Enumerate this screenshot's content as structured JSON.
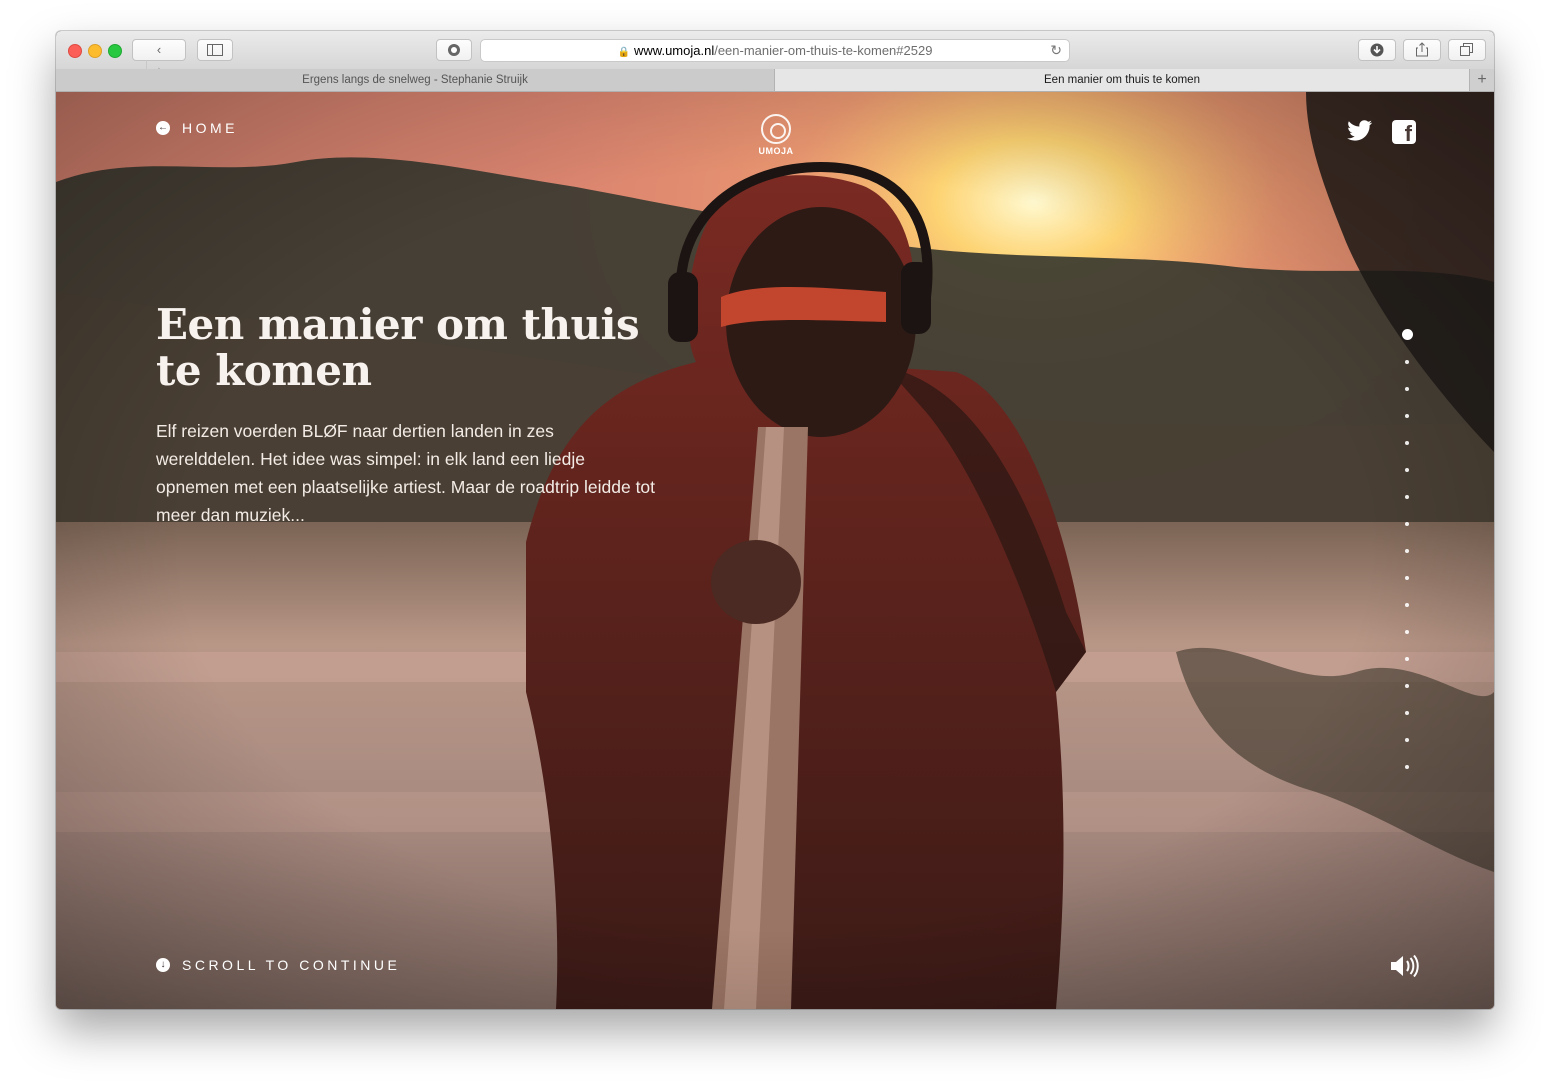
{
  "browser": {
    "url_host": "www.umoja.nl",
    "url_path": "/een-manier-om-thuis-te-komen#2529",
    "tabs": [
      {
        "label": "Ergens langs de snelweg - Stephanie Struijk",
        "active": false
      },
      {
        "label": "Een manier om thuis te komen",
        "active": true
      }
    ],
    "new_tab": "+"
  },
  "page": {
    "home_label": "HOME",
    "logo_text": "UMOJA",
    "title": "Een manier om thuis te komen",
    "intro": "Elf reizen voerden BLØF naar dertien landen in zes werelddelen. Het idee was simpel: in elk land een liedje opnemen met een plaatselijke artiest. Maar de roadtrip leidde tot meer dan muziek...",
    "scroll_label": "SCROLL TO CONTINUE",
    "section_dots_count": 17,
    "active_dot_index": 0
  },
  "icons": {
    "back": "chevron-left-icon",
    "forward": "chevron-right-icon",
    "sidebar": "sidebar-icon",
    "privacy": "privacy-icon",
    "lock": "lock-icon",
    "reload": "reload-icon",
    "download": "download-icon",
    "share": "share-icon",
    "tabs": "tabs-icon",
    "home": "arrow-left-circle-icon",
    "scroll": "arrow-down-circle-icon",
    "twitter": "twitter-icon",
    "facebook": "facebook-icon",
    "sound": "speaker-icon"
  },
  "colors": {
    "text_light": "#ffffff",
    "sunset_sky": "#e6876e",
    "river": "#b58e80"
  }
}
